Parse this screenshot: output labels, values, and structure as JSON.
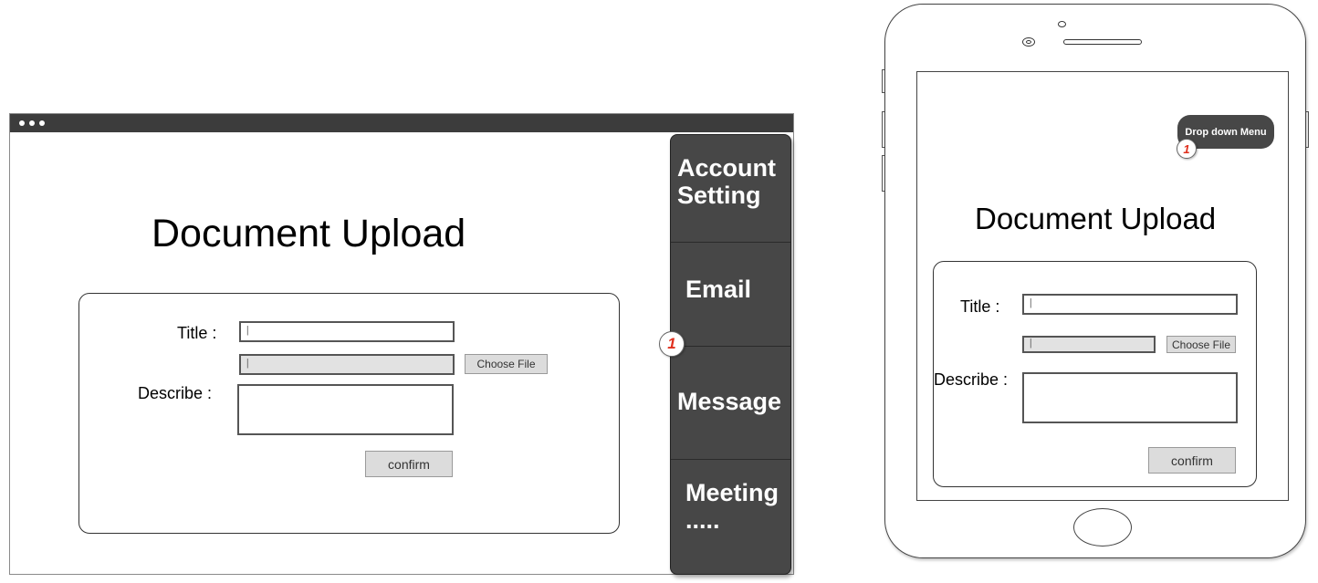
{
  "desktop": {
    "title": "Document Upload",
    "form": {
      "title_label": "Title :",
      "title_value": "|",
      "file_value": "|",
      "choose_file_label": "Choose File",
      "describe_label": "Describe :",
      "confirm_label": "confirm"
    },
    "side_menu": {
      "items": [
        {
          "label_line1": "Account",
          "label_line2": "Setting"
        },
        {
          "label_line1": "Email"
        },
        {
          "label_line1": "Message"
        },
        {
          "label_line1": "Meeting",
          "label_line2": "....."
        }
      ],
      "badge": "1"
    }
  },
  "tablet": {
    "dropdown_label": "Drop down Menu",
    "badge": "1",
    "title": "Document Upload",
    "form": {
      "title_label": "Title :",
      "title_value": "|",
      "file_value": "|",
      "choose_file_label": "Choose File",
      "describe_label": "Describe :",
      "confirm_label": "confirm"
    }
  },
  "colors": {
    "menu_bg": "#474747",
    "browser_bar": "#3c3c3c",
    "badge_text": "#e0301e",
    "button_bg": "#dcdcdc"
  }
}
